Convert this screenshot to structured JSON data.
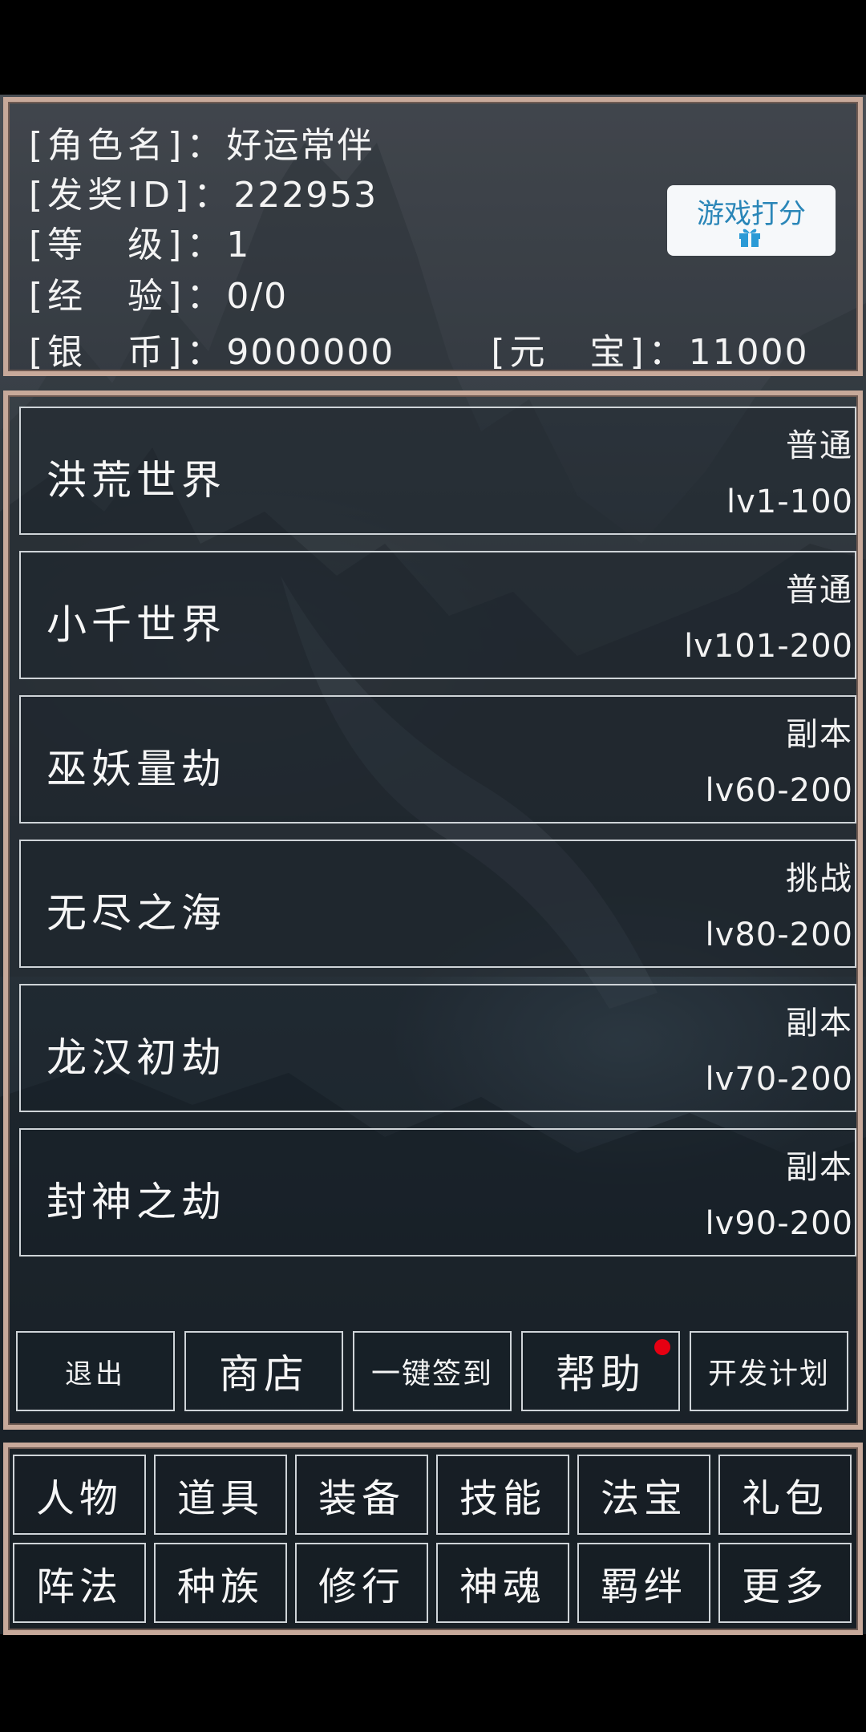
{
  "player": {
    "name_label": "[角色名]：",
    "name": "好运常伴",
    "id_label": "[发奖ID]：",
    "id": "222953",
    "level_label": "[等　级]：",
    "level": "1",
    "exp_label": "[经　验]：",
    "exp": "0/0",
    "silver_label": "[银　币]：",
    "silver": "9000000",
    "ingot_label": "[元　宝]：",
    "ingot": "11000"
  },
  "rate_button": {
    "label": "游戏打分",
    "icon": "gift-icon"
  },
  "worlds": [
    {
      "name": "洪荒世界",
      "type": "普通",
      "level": "lv1-100"
    },
    {
      "name": "小千世界",
      "type": "普通",
      "level": "lv101-200"
    },
    {
      "name": "巫妖量劫",
      "type": "副本",
      "level": "lv60-200"
    },
    {
      "name": "无尽之海",
      "type": "挑战",
      "level": "lv80-200"
    },
    {
      "name": "龙汉初劫",
      "type": "副本",
      "level": "lv70-200"
    },
    {
      "name": "封神之劫",
      "type": "副本",
      "level": "lv90-200"
    }
  ],
  "actions": {
    "exit": "退出",
    "shop": "商店",
    "sign_in": "一键签到",
    "help": "帮助",
    "dev_plan": "开发计划"
  },
  "menu": [
    [
      "人物",
      "道具",
      "装备",
      "技能",
      "法宝",
      "礼包"
    ],
    [
      "阵法",
      "种族",
      "修行",
      "神魂",
      "羁绊",
      "更多"
    ]
  ],
  "colors": {
    "frame": "#c7a99a",
    "card_border": "#cfd4d8",
    "rate_text": "#2a86b8",
    "notification_dot": "#e60012"
  }
}
